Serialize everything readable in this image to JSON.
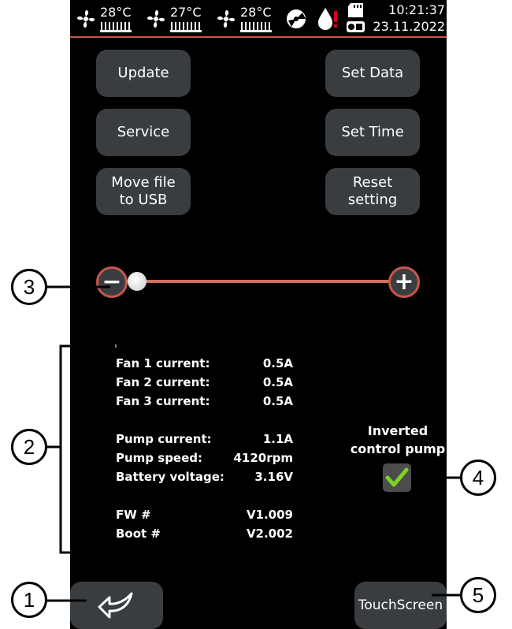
{
  "status_bar": {
    "fans": [
      {
        "icon": "fan-icon",
        "temperature": "28°C"
      },
      {
        "icon": "fan-icon",
        "temperature": "27°C"
      },
      {
        "icon": "fan-icon",
        "temperature": "28°C"
      }
    ],
    "icons": [
      "pump-icon",
      "water-drop-alert-icon",
      "sd-card-icon",
      "battery-icon"
    ],
    "time": "10:21:37",
    "date": "23.11.2022"
  },
  "buttons": {
    "update": "Update",
    "set_data": "Set Data",
    "service": "Service",
    "set_time": "Set Time",
    "move_file": "Move file\nto USB",
    "reset_setting": "Reset\nsetting"
  },
  "slider": {
    "minus_label": "−",
    "plus_label": "+",
    "level": 0.0
  },
  "info": {
    "rows": [
      {
        "label": "Fan 1 current:",
        "value": "0.5A"
      },
      {
        "label": "Fan 2 current:",
        "value": "0.5A"
      },
      {
        "label": "Fan 3 current:",
        "value": "0.5A"
      },
      {
        "label": "Pump current:",
        "value": "1.1A"
      },
      {
        "label": "Pump speed:",
        "value": "4120rpm"
      },
      {
        "label": "Battery voltage:",
        "value": "3.16V"
      },
      {
        "label": "FW #",
        "value": "V1.009"
      },
      {
        "label": "Boot #",
        "value": "V2.002"
      }
    ]
  },
  "inverted_pump": {
    "label": "Inverted\ncontrol pump",
    "checked": true
  },
  "footer": {
    "back_icon": "back-arrow-icon",
    "touchscreen_label": "TouchScreen"
  },
  "callouts": [
    "1",
    "2",
    "3",
    "4",
    "5"
  ],
  "colors": {
    "accent": "#c8574a",
    "button": "#3a3d40",
    "check": "#7ed321"
  }
}
